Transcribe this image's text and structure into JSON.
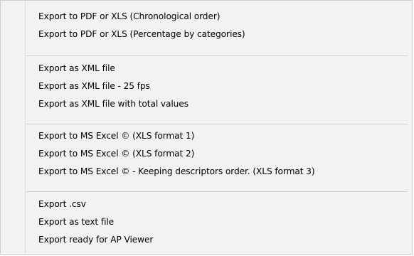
{
  "menu": {
    "groups": [
      {
        "items": [
          "Export to PDF or XLS (Chronological order)",
          "Export to PDF or XLS (Percentage by categories)"
        ]
      },
      {
        "items": [
          "Export as XML file",
          "Export as XML file - 25 fps",
          "Export as XML file with total values"
        ]
      },
      {
        "items": [
          "Export to MS Excel © (XLS format 1)",
          "Export to MS Excel © (XLS format 2)",
          "Export to MS Excel © - Keeping descriptors order. (XLS format 3)"
        ]
      },
      {
        "items": [
          "Export .csv",
          "Export as text file",
          "Export ready for AP Viewer"
        ]
      }
    ]
  }
}
